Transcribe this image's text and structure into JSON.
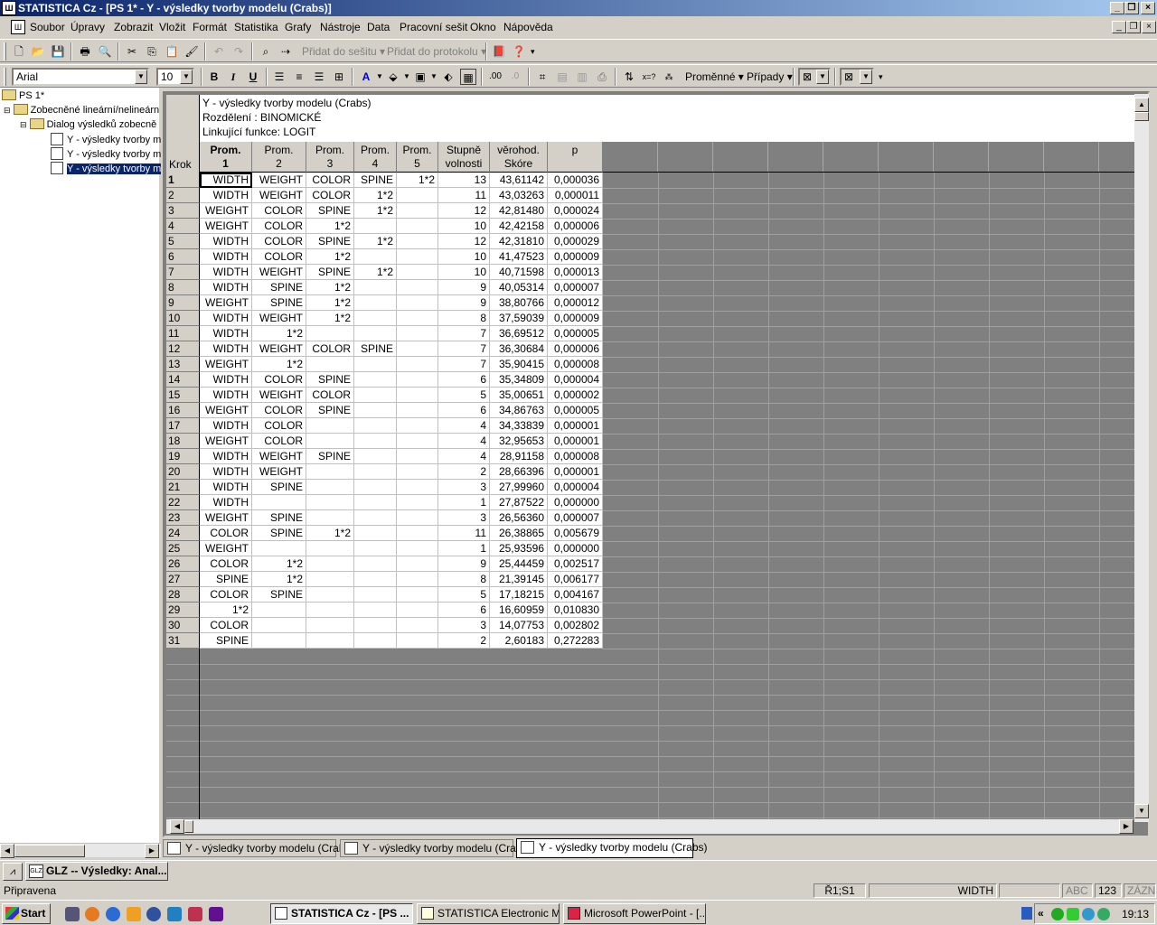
{
  "app": {
    "title": "STATISTICA Cz - [PS 1* - Y - výsledky tvorby modelu (Crabs)]",
    "icon": "statistica-icon"
  },
  "menu": [
    "Soubor",
    "Úpravy",
    "Zobrazit",
    "Vložit",
    "Formát",
    "Statistika",
    "Grafy",
    "Nástroje",
    "Data",
    "Pracovní sešit",
    "Okno",
    "Nápověda"
  ],
  "toolbar": {
    "add_to_workbook": "Přidat do sešitu",
    "add_to_report": "Přidat do protokolu",
    "font_name": "Arial",
    "font_size": "10",
    "bold": "B",
    "italic": "I",
    "underline": "U",
    "variables": "Proměnné",
    "cases": "Případy"
  },
  "tree": {
    "root": "PS 1*",
    "node1": "Zobecněné lineární/nelineárn",
    "node2": "Dialog výsledků zobecně",
    "leaves": [
      "Y - výsledky tvorby m",
      "Y - výsledky tvorby m",
      "Y - výsledky tvorby m"
    ]
  },
  "sheet": {
    "header_lines": [
      "Y - výsledky tvorby modelu (Crabs)",
      "Rozdělení : BINOMICKÉ",
      "Linkující funkce: LOGIT"
    ],
    "corner_label": "Krok",
    "columns": [
      [
        "Prom.",
        "1"
      ],
      [
        "Prom.",
        "2"
      ],
      [
        "Prom.",
        "3"
      ],
      [
        "Prom.",
        "4"
      ],
      [
        "Prom.",
        "5"
      ],
      [
        "Stupně",
        "volnosti"
      ],
      [
        "věrohod.",
        "Skóre"
      ],
      [
        "p",
        ""
      ]
    ],
    "rows": [
      [
        "1",
        "WIDTH",
        "WEIGHT",
        "COLOR",
        "SPINE",
        "1*2",
        "13",
        "43,61142",
        "0,000036"
      ],
      [
        "2",
        "WIDTH",
        "WEIGHT",
        "COLOR",
        "1*2",
        "",
        "11",
        "43,03263",
        "0,000011"
      ],
      [
        "3",
        "WEIGHT",
        "COLOR",
        "SPINE",
        "1*2",
        "",
        "12",
        "42,81480",
        "0,000024"
      ],
      [
        "4",
        "WEIGHT",
        "COLOR",
        "1*2",
        "",
        "",
        "10",
        "42,42158",
        "0,000006"
      ],
      [
        "5",
        "WIDTH",
        "COLOR",
        "SPINE",
        "1*2",
        "",
        "12",
        "42,31810",
        "0,000029"
      ],
      [
        "6",
        "WIDTH",
        "COLOR",
        "1*2",
        "",
        "",
        "10",
        "41,47523",
        "0,000009"
      ],
      [
        "7",
        "WIDTH",
        "WEIGHT",
        "SPINE",
        "1*2",
        "",
        "10",
        "40,71598",
        "0,000013"
      ],
      [
        "8",
        "WIDTH",
        "SPINE",
        "1*2",
        "",
        "",
        "9",
        "40,05314",
        "0,000007"
      ],
      [
        "9",
        "WEIGHT",
        "SPINE",
        "1*2",
        "",
        "",
        "9",
        "38,80766",
        "0,000012"
      ],
      [
        "10",
        "WIDTH",
        "WEIGHT",
        "1*2",
        "",
        "",
        "8",
        "37,59039",
        "0,000009"
      ],
      [
        "11",
        "WIDTH",
        "1*2",
        "",
        "",
        "",
        "7",
        "36,69512",
        "0,000005"
      ],
      [
        "12",
        "WIDTH",
        "WEIGHT",
        "COLOR",
        "SPINE",
        "",
        "7",
        "36,30684",
        "0,000006"
      ],
      [
        "13",
        "WEIGHT",
        "1*2",
        "",
        "",
        "",
        "7",
        "35,90415",
        "0,000008"
      ],
      [
        "14",
        "WIDTH",
        "COLOR",
        "SPINE",
        "",
        "",
        "6",
        "35,34809",
        "0,000004"
      ],
      [
        "15",
        "WIDTH",
        "WEIGHT",
        "COLOR",
        "",
        "",
        "5",
        "35,00651",
        "0,000002"
      ],
      [
        "16",
        "WEIGHT",
        "COLOR",
        "SPINE",
        "",
        "",
        "6",
        "34,86763",
        "0,000005"
      ],
      [
        "17",
        "WIDTH",
        "COLOR",
        "",
        "",
        "",
        "4",
        "34,33839",
        "0,000001"
      ],
      [
        "18",
        "WEIGHT",
        "COLOR",
        "",
        "",
        "",
        "4",
        "32,95653",
        "0,000001"
      ],
      [
        "19",
        "WIDTH",
        "WEIGHT",
        "SPINE",
        "",
        "",
        "4",
        "28,91158",
        "0,000008"
      ],
      [
        "20",
        "WIDTH",
        "WEIGHT",
        "",
        "",
        "",
        "2",
        "28,66396",
        "0,000001"
      ],
      [
        "21",
        "WIDTH",
        "SPINE",
        "",
        "",
        "",
        "3",
        "27,99960",
        "0,000004"
      ],
      [
        "22",
        "WIDTH",
        "",
        "",
        "",
        "",
        "1",
        "27,87522",
        "0,000000"
      ],
      [
        "23",
        "WEIGHT",
        "SPINE",
        "",
        "",
        "",
        "3",
        "26,56360",
        "0,000007"
      ],
      [
        "24",
        "COLOR",
        "SPINE",
        "1*2",
        "",
        "",
        "11",
        "26,38865",
        "0,005679"
      ],
      [
        "25",
        "WEIGHT",
        "",
        "",
        "",
        "",
        "1",
        "25,93596",
        "0,000000"
      ],
      [
        "26",
        "COLOR",
        "1*2",
        "",
        "",
        "",
        "9",
        "25,44459",
        "0,002517"
      ],
      [
        "27",
        "SPINE",
        "1*2",
        "",
        "",
        "",
        "8",
        "21,39145",
        "0,006177"
      ],
      [
        "28",
        "COLOR",
        "SPINE",
        "",
        "",
        "",
        "5",
        "17,18215",
        "0,004167"
      ],
      [
        "29",
        "1*2",
        "",
        "",
        "",
        "",
        "6",
        "16,60959",
        "0,010830"
      ],
      [
        "30",
        "COLOR",
        "",
        "",
        "",
        "",
        "3",
        "14,07753",
        "0,002802"
      ],
      [
        "31",
        "SPINE",
        "",
        "",
        "",
        "",
        "2",
        "2,60183",
        "0,272283"
      ]
    ]
  },
  "sheet_tabs": [
    "Y - výsledky tvorby modelu (Crabs)",
    "Y - výsledky tvorby modelu (Crabs)",
    "Y - výsledky tvorby modelu (Crabs)"
  ],
  "window_task": "GLZ -- Výsledky: Anal...",
  "status": {
    "text": "Připravena",
    "cell_ref": "Ř1;S1",
    "cell_value": "WIDTH",
    "abc": "ABC",
    "num": "123",
    "rec": "ZÁZN"
  },
  "taskbar": {
    "start": "Start",
    "buttons": [
      "STATISTICA Cz - [PS ...",
      "STATISTICA Electronic M...",
      "Microsoft PowerPoint - [..."
    ],
    "clock": "19:13",
    "chevron": "«"
  },
  "colors": {
    "title_gradient_start": "#0a246a",
    "title_gradient_end": "#a6caf0",
    "face": "#d4d0c8",
    "sheet_background": "#808080"
  }
}
